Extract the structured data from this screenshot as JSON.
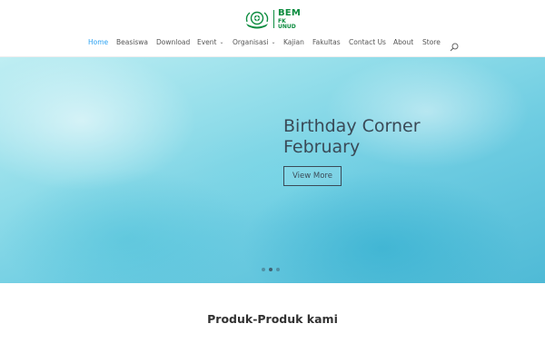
{
  "header": {
    "logo": {
      "line1": "BEM",
      "line2": "FK UNUD",
      "emblem_icon": "seal-emblem-icon",
      "color": "#0c8c3f"
    },
    "nav": [
      {
        "label": "Home",
        "active": true
      },
      {
        "label": "Beasiswa"
      },
      {
        "label": "Download"
      },
      {
        "label": "Event",
        "dropdown": true
      },
      {
        "label": "Organisasi",
        "dropdown": true
      },
      {
        "label": "Kajian"
      },
      {
        "label": "Fakultas"
      },
      {
        "label": "Contact Us"
      },
      {
        "label": "About"
      },
      {
        "label": "Store"
      }
    ],
    "search_icon": "search-icon",
    "active_color": "#2ea3f2"
  },
  "hero": {
    "title_line1": "Birthday Corner",
    "title_line2": "February",
    "button_label": "View More",
    "slides": 3,
    "active_slide": 2
  },
  "section": {
    "title": "Produk-Produk kami"
  }
}
